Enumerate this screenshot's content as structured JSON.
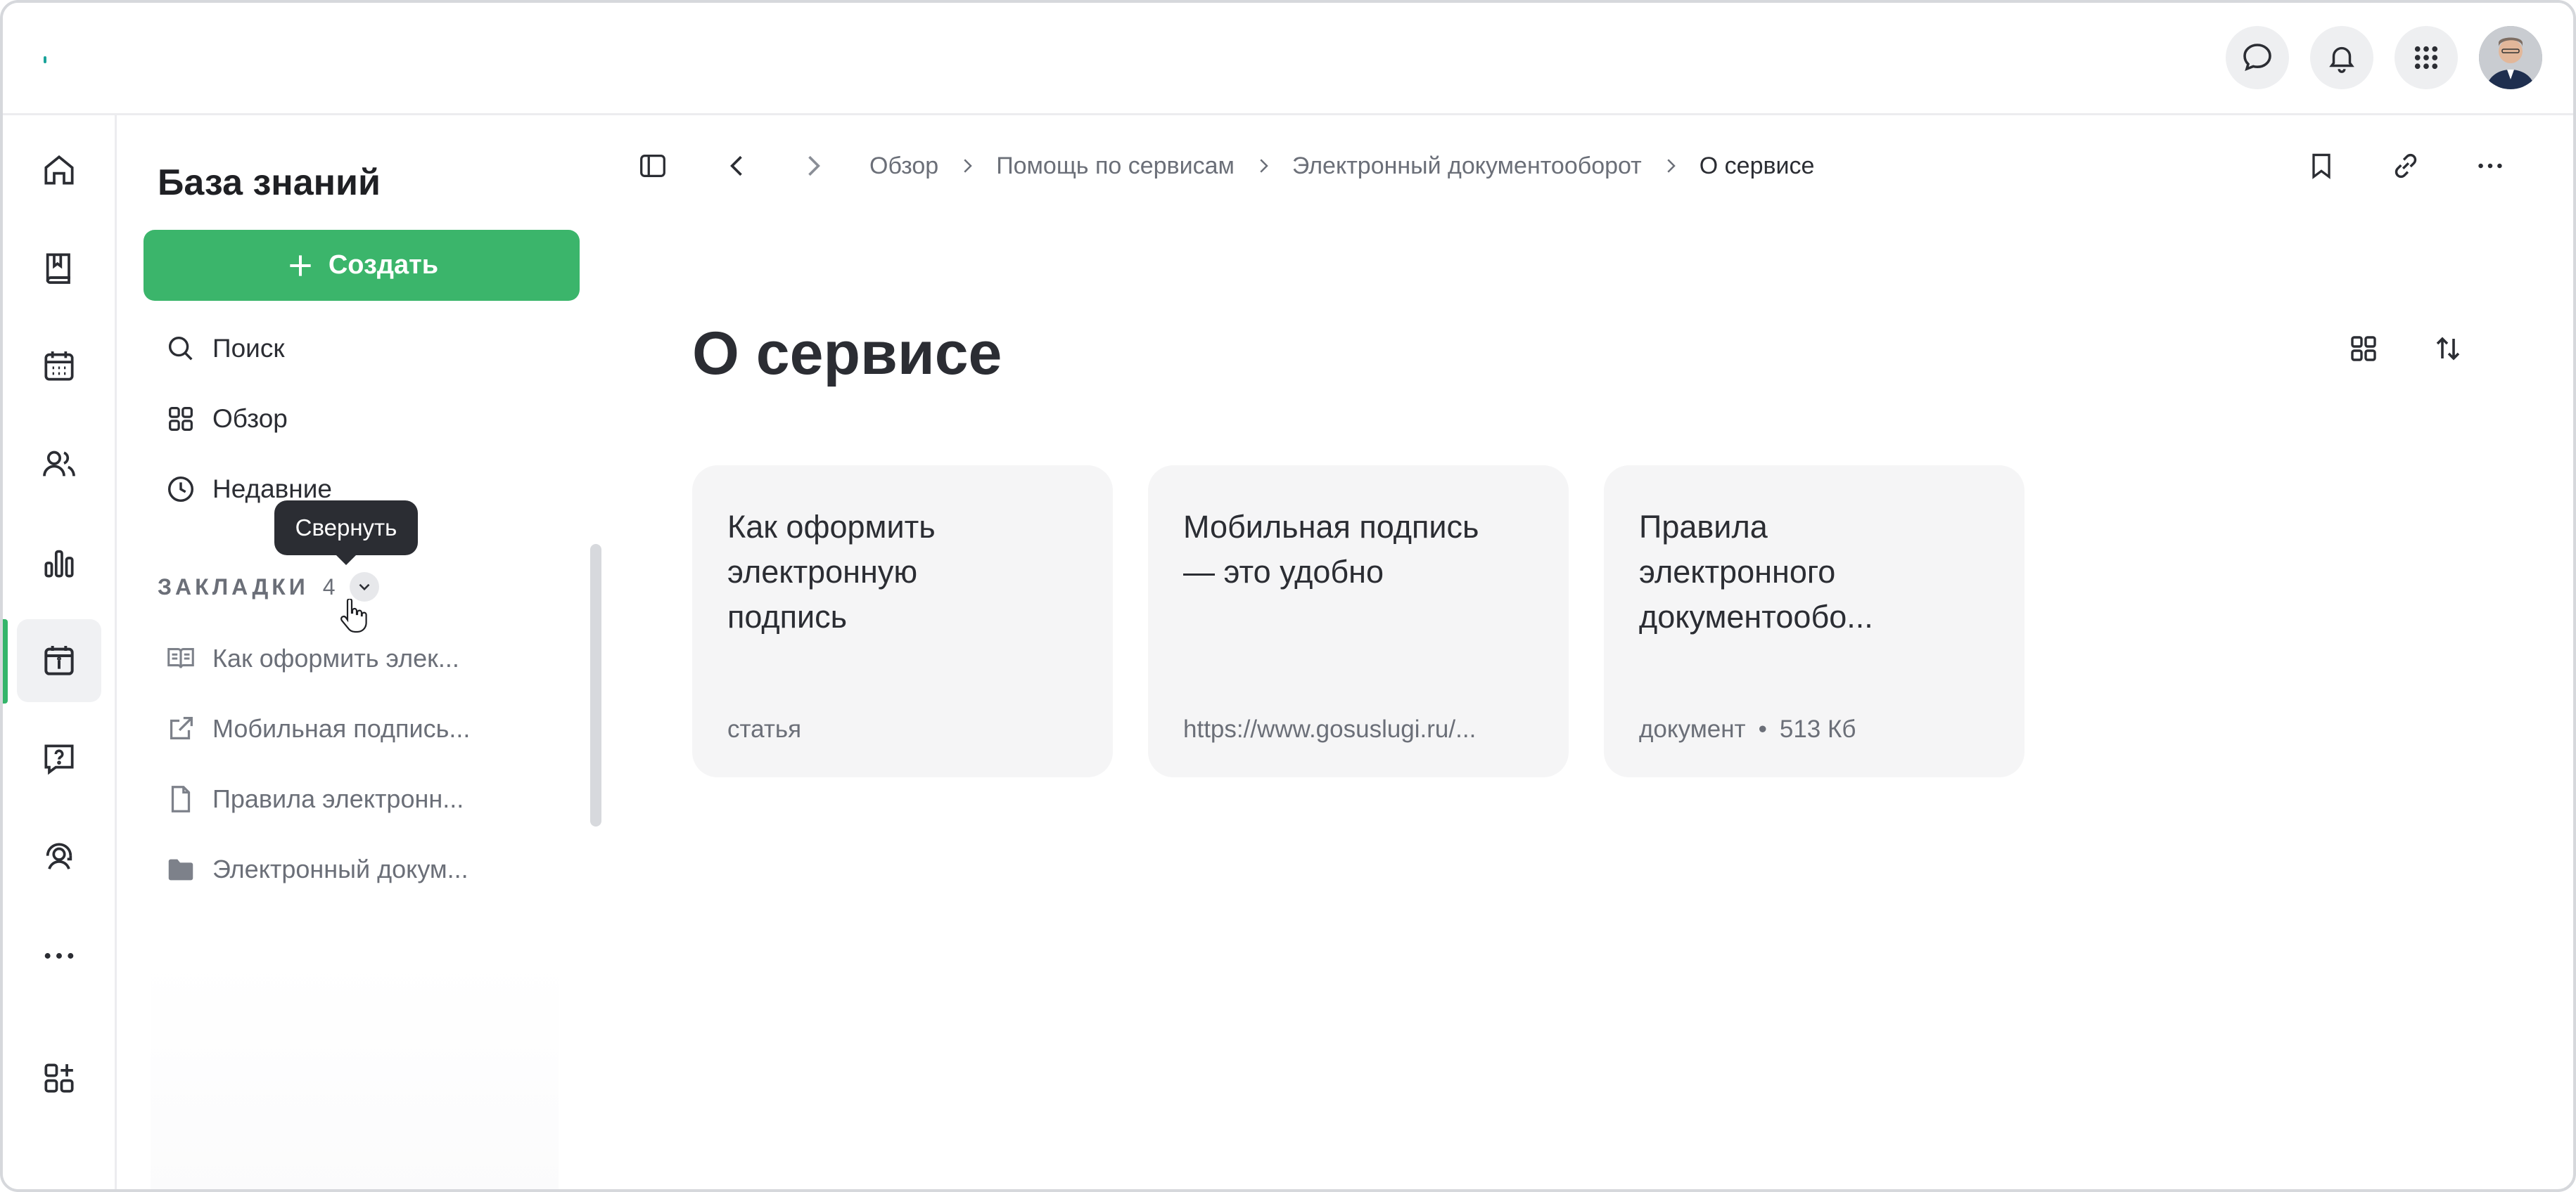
{
  "sidebar": {
    "title": "База знаний",
    "create_label": "Создать",
    "nav": [
      {
        "label": "Поиск",
        "icon": "search-icon"
      },
      {
        "label": "Обзор",
        "icon": "grid-icon"
      },
      {
        "label": "Недавние",
        "icon": "clock-icon"
      }
    ],
    "bookmarks_heading": "ЗАКЛАДКИ",
    "bookmarks_count": "4",
    "bookmarks": [
      {
        "label": "Как оформить элек...",
        "icon": "article-icon"
      },
      {
        "label": "Мобильная подпись...",
        "icon": "external-link-icon"
      },
      {
        "label": "Правила электронн...",
        "icon": "document-icon"
      },
      {
        "label": "Электронный докум...",
        "icon": "folder-icon"
      }
    ]
  },
  "tooltip": "Свернуть",
  "breadcrumb": [
    "Обзор",
    "Помощь по сервисам",
    "Электронный документооборот",
    "О сервисе"
  ],
  "page": {
    "title": "О сервисе"
  },
  "cards": [
    {
      "title": "Как оформить электронную подпись",
      "meta": "статья",
      "meta2": ""
    },
    {
      "title": "Мобильная подпись — это удобно",
      "meta": "https://www.gosuslugi.ru/...",
      "meta2": ""
    },
    {
      "title": "Правила электронного документообо...",
      "meta": "документ",
      "meta2": "513 Кб"
    }
  ],
  "colors": {
    "accent": "#3bb56b",
    "text": "#2b2d33",
    "muted": "#6b6f78",
    "card_bg": "#f5f5f6"
  }
}
